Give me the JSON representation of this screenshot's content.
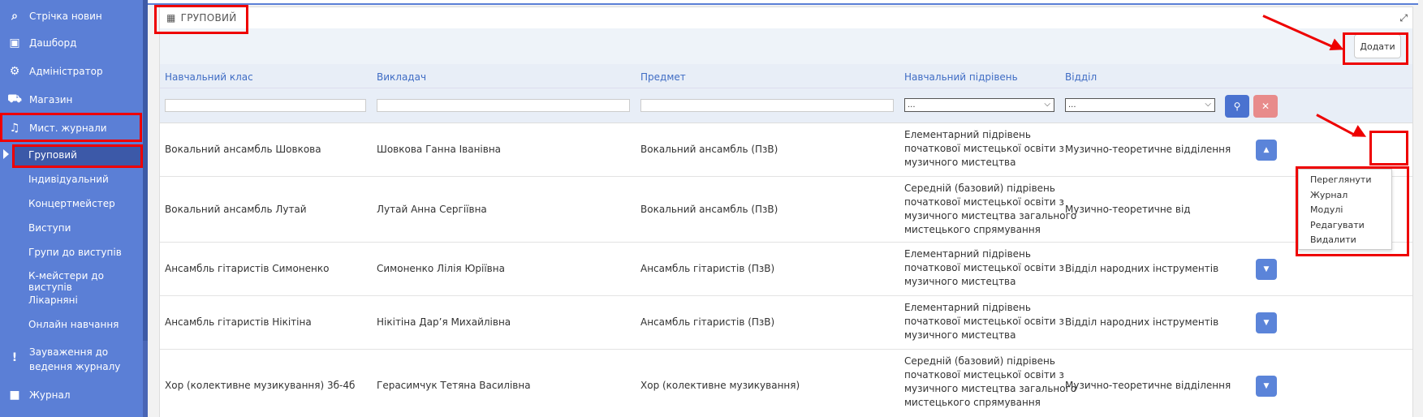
{
  "sidebar": {
    "items": [
      {
        "label": "Стрічка новин",
        "icon": "rss-icon",
        "glyph": "⌕"
      },
      {
        "label": "Дашборд",
        "icon": "dashboard-icon",
        "glyph": "▣"
      },
      {
        "label": "Адміністратор",
        "icon": "gear-icon",
        "glyph": "⚙"
      },
      {
        "label": "Магазин",
        "icon": "cart-icon",
        "glyph": "⛟"
      },
      {
        "label": "Мист. журнали",
        "icon": "music-icon",
        "glyph": "♫"
      }
    ],
    "subitems": [
      "Груповий",
      "Індивідуальний",
      "Концертмейстер",
      "Виступи",
      "Групи до виступів",
      "К-мейстери до виступів",
      "Лікарняні",
      "Онлайн навчання"
    ],
    "bottom_items": [
      {
        "label_line1": "Зауваження до",
        "label_line2": "ведення журналу",
        "icon": "exclamation-icon",
        "glyph": "!"
      },
      {
        "label": "Журнал",
        "icon": "bookmark-icon",
        "glyph": "■"
      }
    ]
  },
  "panel": {
    "title": "ГРУПОВИЙ",
    "add_label": "Додати"
  },
  "table": {
    "headers": [
      "Навчальний клас",
      "Викладач",
      "Предмет",
      "Навчальний підрівень",
      "Відділ"
    ],
    "select_placeholder": "...",
    "rows": [
      {
        "class": "Вокальний ансамбль Шовкова",
        "teacher": "Шовкова Ганна Іванівна",
        "subject": "Вокальний ансамбль (ПзВ)",
        "level": [
          "Елементарний підрівень",
          "початкової мистецької освіти з",
          "музичного мистецтва"
        ],
        "dept": "Музично-теоретичне відділення"
      },
      {
        "class": "Вокальний ансамбль Лутай",
        "teacher": "Лутай Анна Сергіївна",
        "subject": "Вокальний ансамбль (ПзВ)",
        "level": [
          "Середній (базовий) підрівень",
          "початкової мистецької освіти з",
          "музичного мистецтва загального",
          "мистецького спрямування"
        ],
        "dept": "Музично-теоретичне від"
      },
      {
        "class": "Ансамбль гітаристів Симоненко",
        "teacher": "Симоненко Лілія Юріївна",
        "subject": "Ансамбль гітаристів (ПзВ)",
        "level": [
          "Елементарний підрівень",
          "початкової мистецької освіти з",
          "музичного мистецтва"
        ],
        "dept": "Відділ народних інструментів"
      },
      {
        "class": "Ансамбль гітаристів Нікітіна",
        "teacher": "Нікітіна Дар’я Михайлівна",
        "subject": "Ансамбль гітаристів (ПзВ)",
        "level": [
          "Елементарний підрівень",
          "початкової мистецької освіти з",
          "музичного мистецтва"
        ],
        "dept": "Відділ народних інструментів"
      },
      {
        "class": "Хор (колективне музикування) 3б-4б",
        "teacher": "Герасимчук Тетяна Василівна",
        "subject": "Хор (колективне музикування)",
        "level": [
          "Середній (базовий) підрівень",
          "початкової мистецької освіти з",
          "музичного мистецтва загального",
          "мистецького спрямування"
        ],
        "dept": "Музично-теоретичне відділення"
      }
    ]
  },
  "dropdown": {
    "items": [
      "Переглянути",
      "Журнал",
      "Модулі",
      "Редагувати",
      "Видалити"
    ]
  },
  "colors": {
    "sidebar": "#5b7fd6",
    "active": "#3c59a8",
    "accent": "#3f6cc4",
    "annotation": "#ee0000"
  }
}
